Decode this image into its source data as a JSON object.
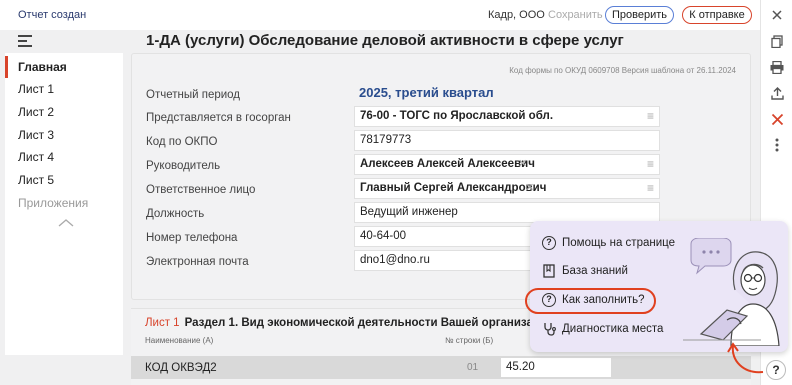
{
  "header": {
    "status": "Отчет создан",
    "org": "Кадр, ООО",
    "save_label": "Сохранить",
    "check_label": "Проверить",
    "send_label": "К отправке"
  },
  "page_title": "1-ДА (услуги) Обследование деловой активности в сфере услуг",
  "sidebar": {
    "items": [
      {
        "label": "Главная"
      },
      {
        "label": "Лист 1"
      },
      {
        "label": "Лист 2"
      },
      {
        "label": "Лист 3"
      },
      {
        "label": "Лист 4"
      },
      {
        "label": "Лист 5"
      },
      {
        "label": "Приложения"
      }
    ],
    "collapse_icon": "chevron-up-icon"
  },
  "form": {
    "code_info": "Код формы по ОКУД 0609708 Версия шаблона от 26.11.2024",
    "period_label": "Отчетный период",
    "period_value": "2025, третий квартал",
    "fields": [
      {
        "label": "Представляется в госорган",
        "value": "76-00 - ТОГС по Ярославской обл."
      },
      {
        "label": "Код по ОКПО",
        "value": "78179773"
      },
      {
        "label": "Руководитель",
        "value": "Алексеев Алексей Алексеевич"
      },
      {
        "label": "Ответственное лицо",
        "value": "Главный Сергей Александрович"
      },
      {
        "label": "Должность",
        "value": "Ведущий инженер"
      },
      {
        "label": "Номер телефона",
        "value": "40-64-00"
      },
      {
        "label": "Электронная почта",
        "value": "dno1@dno.ru"
      }
    ]
  },
  "section": {
    "sheet": "Лист 1",
    "title": "Раздел 1. Вид экономической деятельности Вашей организации",
    "col_a": "Наименование (А)",
    "col_b": "№ строки (Б)",
    "row": {
      "name": "КОД ОКВЭД2",
      "num": "01",
      "value": "45.20"
    }
  },
  "help_popup": {
    "items": [
      {
        "label": "Помощь на странице",
        "icon": "question-circle-icon"
      },
      {
        "label": "База знаний",
        "icon": "book-icon"
      },
      {
        "label": "Как заполнить?",
        "icon": "question-circle-icon"
      },
      {
        "label": "Диагностика места",
        "icon": "stethoscope-icon"
      }
    ]
  },
  "help_button": "?",
  "colors": {
    "accent_red": "#d8442b",
    "accent_blue": "#5a7fd6",
    "popup_bg": "#ebe6f7"
  }
}
